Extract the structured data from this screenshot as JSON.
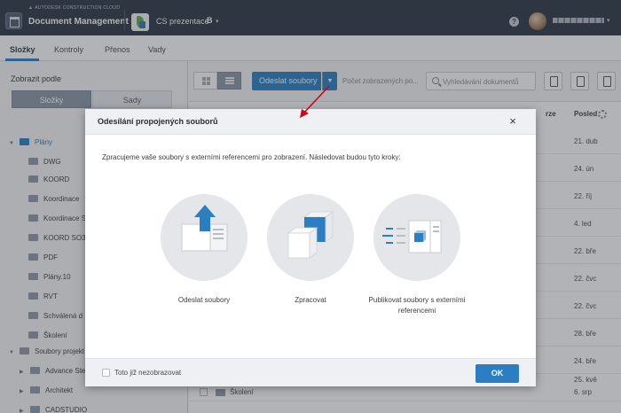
{
  "header": {
    "brand": "AUTODESK CONSTRUCTION CLOUD",
    "module": "Document Management",
    "project": "CS prezentace",
    "project_badge": "B",
    "help": "?"
  },
  "tabs": [
    {
      "label": "Složky"
    },
    {
      "label": "Kontroly"
    },
    {
      "label": "Přenos"
    },
    {
      "label": "Vady"
    }
  ],
  "sidebar": {
    "filter_label": "Zobrazit podle",
    "seg_folders": "Složky",
    "seg_sets": "Sady",
    "root": "Plány",
    "items": [
      "DWG",
      "KOORD",
      "Koordinace",
      "Koordinace S",
      "KOORD SO3",
      "PDF",
      "Plány.10",
      "RVT",
      "Schválená d",
      "Školení"
    ],
    "root2": "Soubory projekt",
    "items2": [
      "Advance Ste",
      "Architekt",
      "CADSTUDIO"
    ]
  },
  "toolbar": {
    "upload_label": "Odeslat soubory",
    "count_label": "Počet zobrazených po...",
    "search_placeholder": "Vyhledávání dokumentů"
  },
  "table": {
    "col_version": "rze",
    "col_last": "Posled",
    "dates": [
      "21. dub",
      "24. ún",
      "22. říj",
      "4. led",
      "22. bře",
      "22. čvc",
      "22. čvc",
      "28. bře",
      "24. bře",
      "25. kvě",
      "28. bře",
      "6. srp"
    ],
    "partial_row_name": "Školení"
  },
  "modal": {
    "title": "Odesílání propojených souborů",
    "close": "×",
    "intro": "Zpracujeme vaše soubory s externími referencemi pro zobrazení. Následovat budou tyto kroky:",
    "steps": [
      {
        "label": "Odeslat soubory",
        "icon": "upload-files-icon"
      },
      {
        "label": "Zpracovat",
        "icon": "process-cubes-icon"
      },
      {
        "label": "Publikovat soubory s externími referencemi",
        "icon": "publish-icon"
      }
    ],
    "checkbox_label": "Toto již nezobrazovat",
    "ok_label": "OK"
  },
  "colors": {
    "accent": "#2b7ec1",
    "topbar": "#2c3644",
    "annotation": "#d0021b"
  }
}
